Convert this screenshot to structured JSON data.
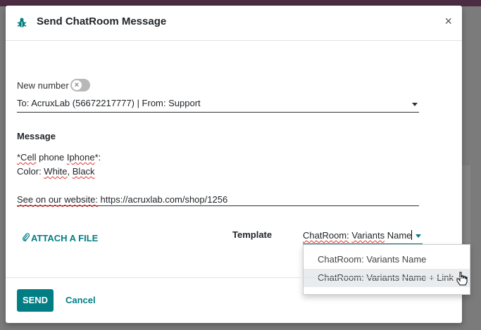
{
  "dialog": {
    "title": "Send ChatRoom Message",
    "close_icon": "close-icon",
    "bug_icon": "bug-icon"
  },
  "form": {
    "new_number_label": "New number",
    "new_number_enabled": false,
    "to_value": "To: AcruxLab (56672217777) | From: Support",
    "message_label": "Message",
    "message_lines": [
      "*Cell phone Iphone*:",
      "Color: White, Black",
      "",
      "See on our website: https://acruxlab.com/shop/1256"
    ],
    "attach_label": "ATTACH A FILE",
    "template_label": "Template",
    "template_value": "ChatRoom: Variants Name"
  },
  "dropdown": {
    "options": [
      "ChatRoom: Variants Name",
      "ChatRoom: Variants Name + Link"
    ],
    "hovered_index": 1
  },
  "footer": {
    "send_label": "SEND",
    "cancel_label": "Cancel"
  },
  "colors": {
    "primary": "#017e84",
    "topbar": "#4b2c42"
  }
}
